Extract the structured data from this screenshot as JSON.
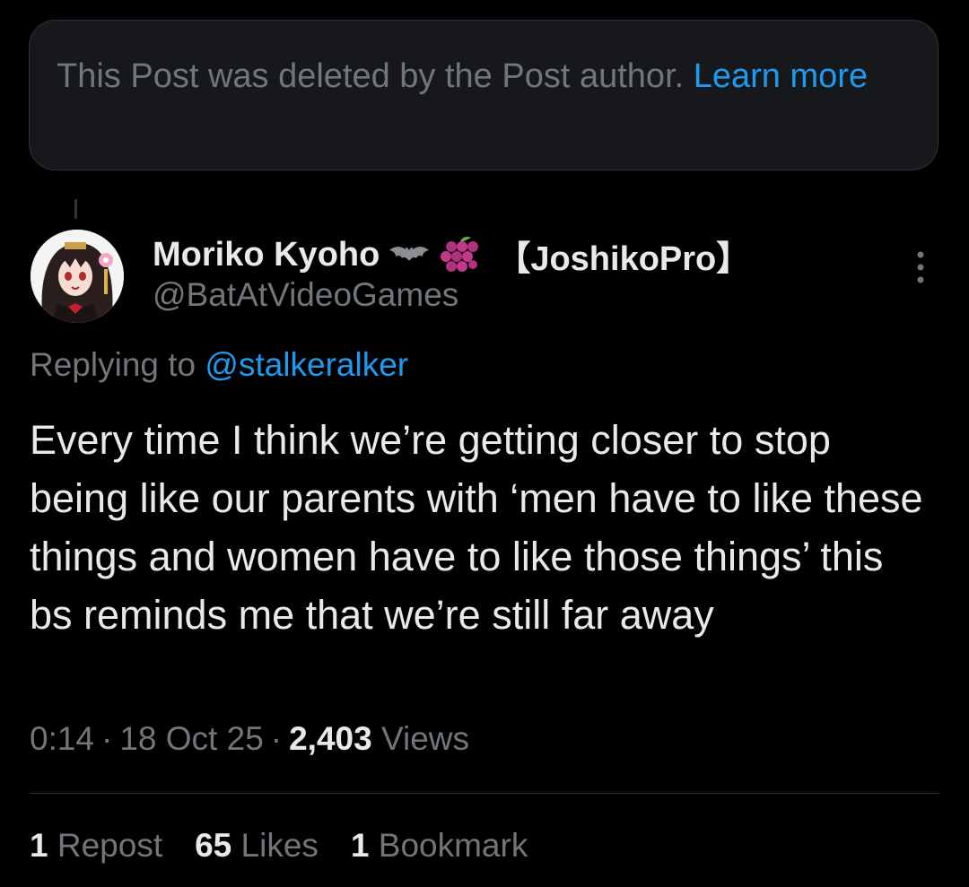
{
  "deleted_notice": {
    "text": "This Post was deleted by the Post author. ",
    "link_label": "Learn more"
  },
  "author": {
    "display_name": "Moriko Kyoho",
    "name_emojis": [
      "bat-emoji",
      "grapes-emoji"
    ],
    "name_suffix": "【JoshikoPro】",
    "handle": "@BatAtVideoGames"
  },
  "reply": {
    "prefix": "Replying to ",
    "mention": "@stalkeralker"
  },
  "tweet": {
    "text": "Every time I think we’re getting closer to stop being like our parents with ‘men have to like these things and women have to like those things’ this bs reminds me that we’re still far away"
  },
  "meta": {
    "time": "0:14",
    "separator": "·",
    "date": "18 Oct 25",
    "views_count": "2,403",
    "views_label": "Views"
  },
  "stats": {
    "reposts_count": "1",
    "reposts_label": "Repost",
    "likes_count": "65",
    "likes_label": "Likes",
    "bookmarks_count": "1",
    "bookmarks_label": "Bookmark"
  },
  "colors": {
    "background": "#000000",
    "card_background": "#16181c",
    "primary_text": "#e7e9ea",
    "secondary_text": "#71767b",
    "link": "#1d9bf0",
    "divider": "#2f3336"
  },
  "icons": {
    "more": "more-options-icon"
  }
}
